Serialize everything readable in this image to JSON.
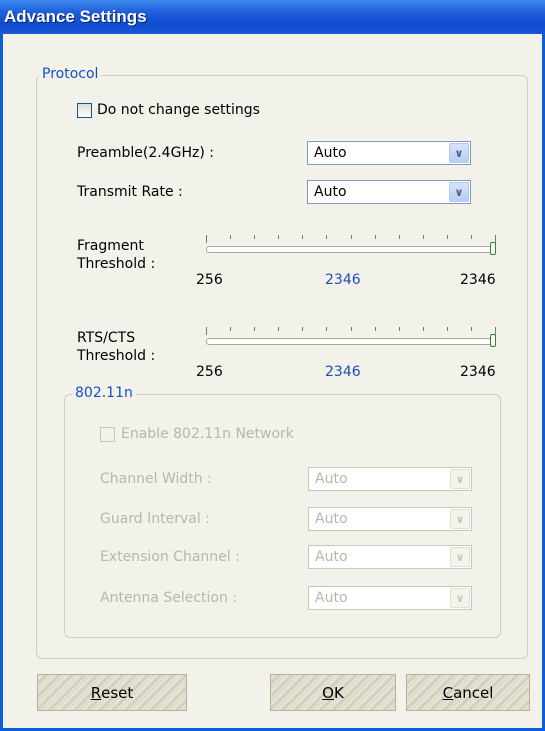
{
  "window": {
    "title": "Advance Settings"
  },
  "protocol": {
    "legend": "Protocol",
    "no_change_label": "Do not change settings",
    "preamble": {
      "label": "Preamble(2.4GHz) :",
      "value": "Auto"
    },
    "transmit_rate": {
      "label": "Transmit Rate :",
      "value": "Auto"
    },
    "fragment": {
      "label_line1": "Fragment",
      "label_line2": "Threshold :",
      "min": "256",
      "current": "2346",
      "max": "2346",
      "level": 1.0
    },
    "rts": {
      "label_line1": "RTS/CTS",
      "label_line2": "Threshold :",
      "min": "256",
      "current": "2346",
      "max": "2346",
      "level": 1.0
    }
  },
  "n80211": {
    "legend": "802.11n",
    "enable_label": "Enable 802.11n Network",
    "channel_width": {
      "label": "Channel Width :",
      "value": "Auto"
    },
    "guard_interval": {
      "label": "Guard Interval :",
      "value": "Auto"
    },
    "extension_channel": {
      "label": "Extension Channel :",
      "value": "Auto"
    },
    "antenna_selection": {
      "label": "Antenna Selection :",
      "value": "Auto"
    }
  },
  "buttons": {
    "reset": {
      "mnemonic": "R",
      "rest": "eset"
    },
    "ok": {
      "mnemonic": "O",
      "rest": "K"
    },
    "cancel": {
      "mnemonic": "C",
      "rest": "ancel"
    }
  },
  "icons": {
    "dropdown": "chevron-down-icon"
  },
  "colors": {
    "title_bar": "#0f4cd0",
    "legend": "#1550c8",
    "value_blue": "#1f4fb5"
  }
}
